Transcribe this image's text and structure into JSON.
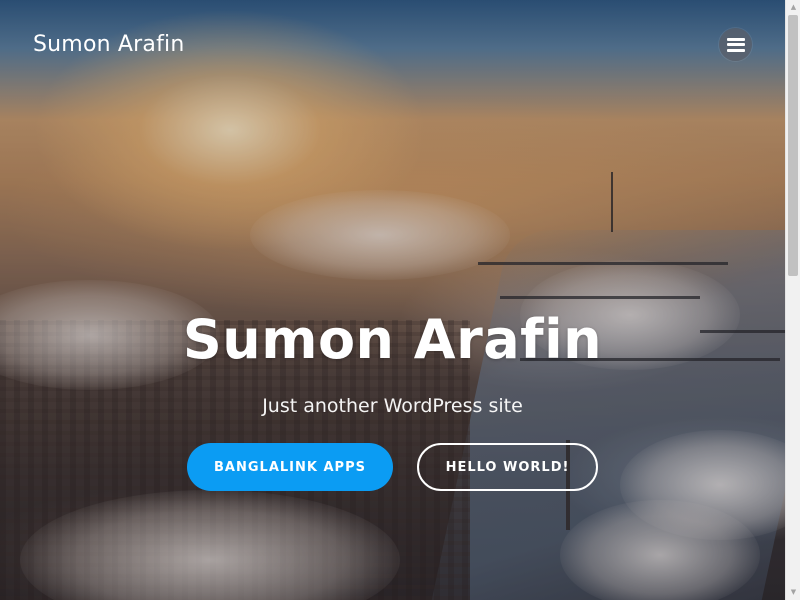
{
  "header": {
    "site_title": "Sumon Arafin",
    "menu_icon": "hamburger-menu-icon"
  },
  "hero": {
    "heading": "Sumon Arafin",
    "tagline": "Just another WordPress site",
    "buttons": [
      {
        "label": "BANGLALINK APPS",
        "style": "primary",
        "color": "#0b9cf3"
      },
      {
        "label": "HELLO WORLD!",
        "style": "outline",
        "color": "#ffffff"
      }
    ]
  },
  "scrollbar": {
    "up_icon": "scroll-up-arrow-icon",
    "down_icon": "scroll-down-arrow-icon"
  },
  "colors": {
    "accent": "#0b9cf3",
    "text": "#ffffff"
  }
}
